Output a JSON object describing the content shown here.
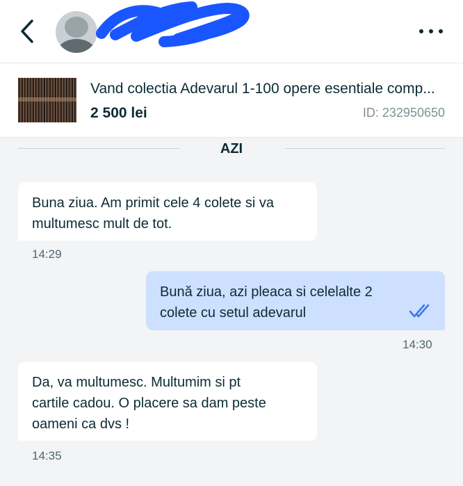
{
  "header": {
    "back_icon": "chevron-left-icon",
    "avatar_icon": "user-avatar-icon",
    "more_icon": "more-horizontal-icon"
  },
  "listing": {
    "title": "Vand colectia Adevarul 1-100 opere esentiale comp...",
    "price": "2 500 lei",
    "id": "ID: 232950650"
  },
  "day_separator": "AZI",
  "messages": [
    {
      "direction": "incoming",
      "lines": [
        "Buna ziua. Am primit cele 4 colete si va",
        "multumesc mult de tot."
      ],
      "time": "14:29"
    },
    {
      "direction": "outgoing",
      "lines": [
        "Bună ziua,  azi pleaca si celelalte 2",
        "colete cu setul adevarul"
      ],
      "time": "14:30",
      "status_icon": "double-check-icon"
    },
    {
      "direction": "incoming",
      "lines": [
        "Da, va multumesc. Multumim si pt",
        "cartile cadou. O placere sa dam peste",
        "oameni ca dvs !"
      ],
      "time": "14:35"
    }
  ],
  "colors": {
    "outgoing_bubble": "#cde0ff",
    "incoming_bubble": "#ffffff",
    "background": "#f2f4f5",
    "text": "#0b2b34",
    "check": "#3a77e6",
    "redaction": "#1a56ff"
  }
}
